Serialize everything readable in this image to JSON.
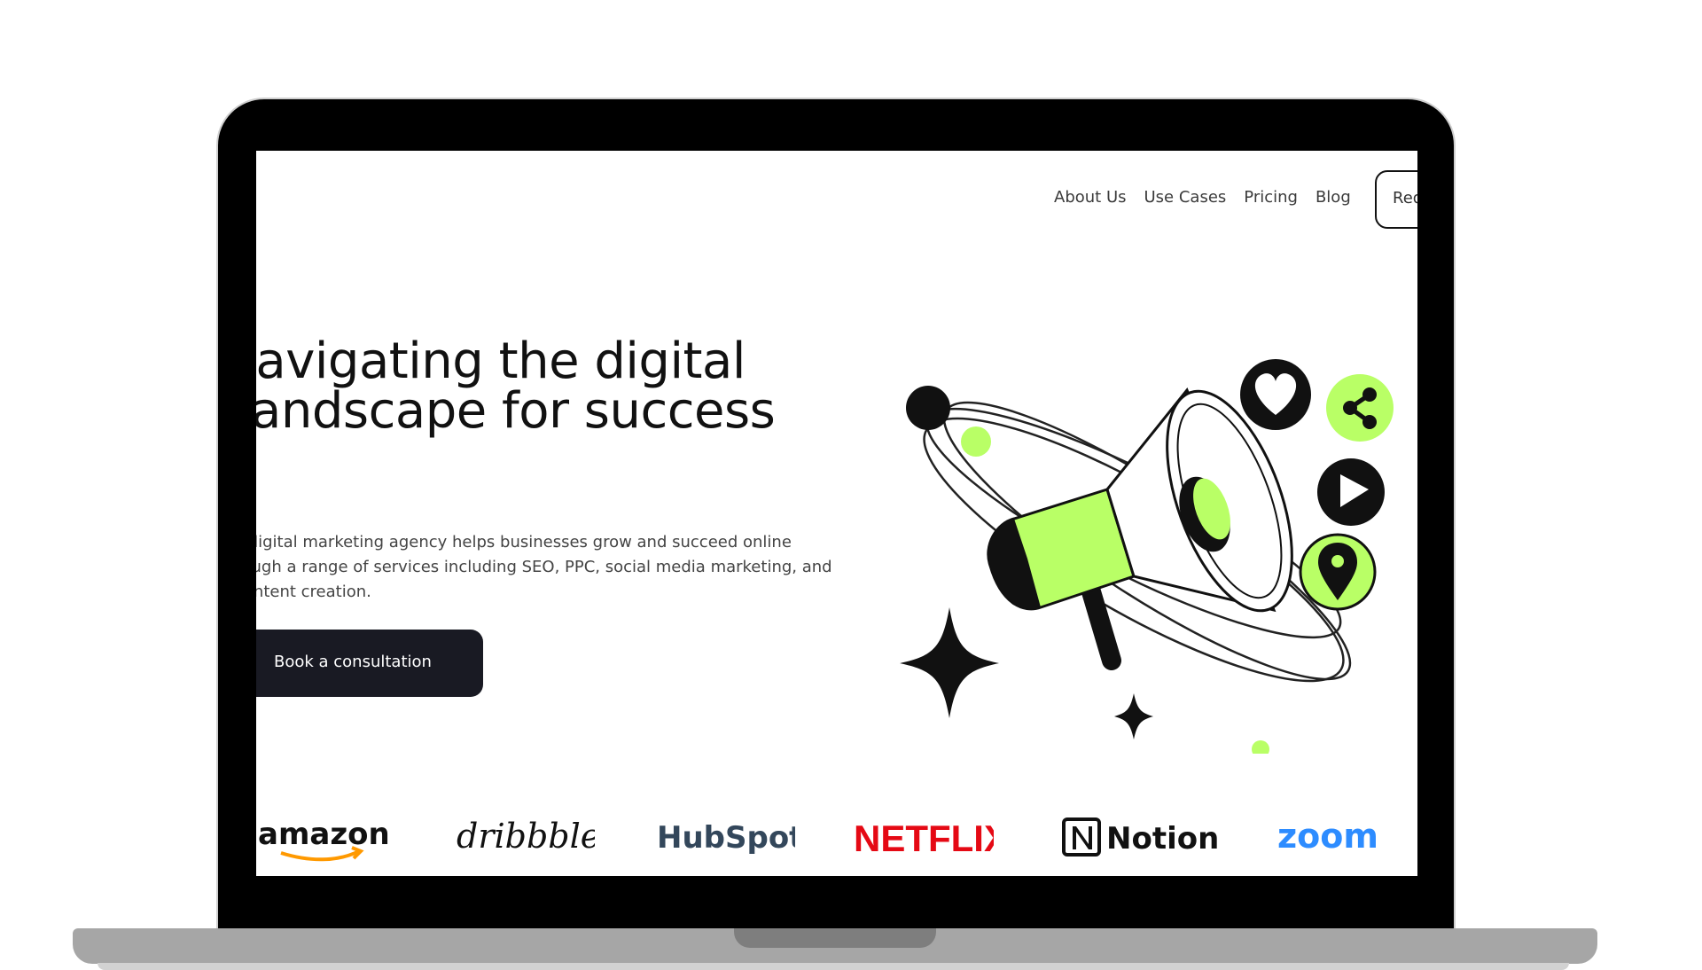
{
  "nav": {
    "items": [
      "About Us",
      "Use Cases",
      "Pricing",
      "Blog"
    ],
    "button_label": "Request a quote"
  },
  "hero": {
    "title_line1": "Navigating the digital",
    "title_line2": "landscape for success",
    "desc_line1": "Our digital marketing agency helps businesses grow and succeed online",
    "desc_line2": "through a range of services including SEO, PPC, social media marketing, and",
    "desc_line3": "content creation.",
    "cta_label": "Book a consultation"
  },
  "logos": [
    "amazon",
    "dribbble",
    "HubSpot",
    "NETFLIX",
    "Notion",
    "zoom"
  ],
  "colors": {
    "accent": "#B9FF66",
    "dark": "#191A23",
    "netflix": "#E50914",
    "zoom": "#2D8CFF",
    "hubspot": "#33475B",
    "hubspot_dot": "#FF7A59",
    "amazon_arrow": "#FF9900"
  },
  "icons": [
    "heart-icon",
    "share-icon",
    "play-icon",
    "location-pin-icon",
    "megaphone-icon",
    "sparkle-icon"
  ]
}
